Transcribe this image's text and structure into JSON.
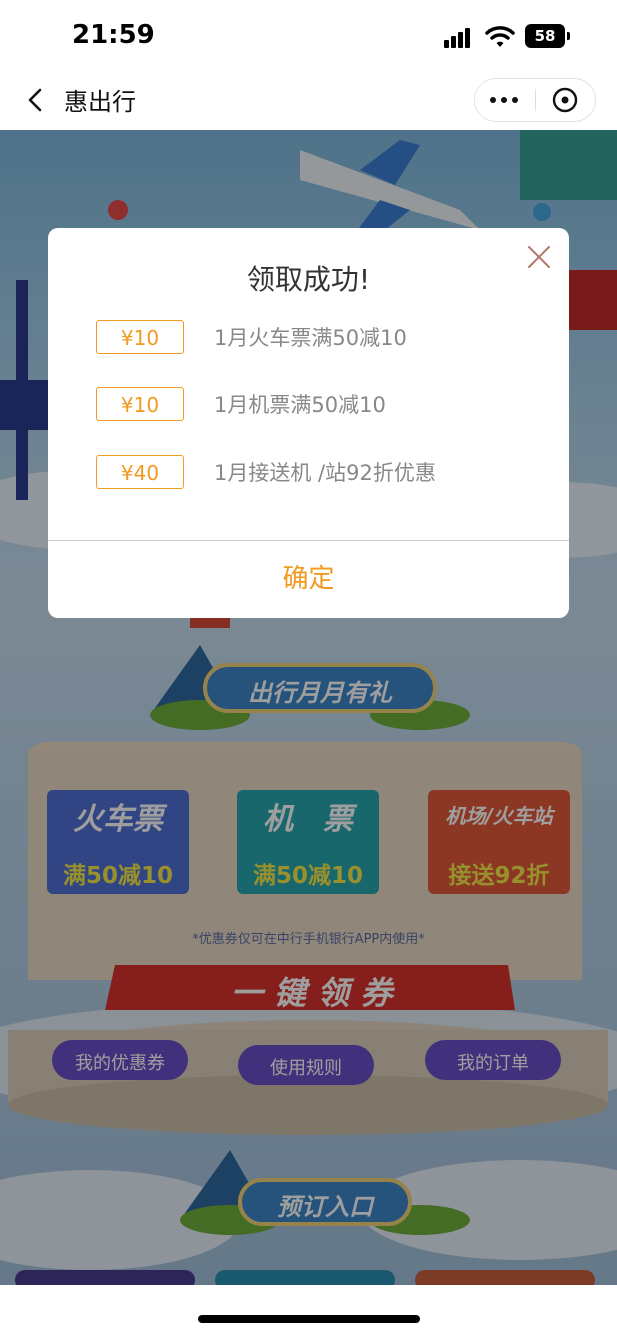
{
  "status": {
    "time": "21:59",
    "battery": "58"
  },
  "nav": {
    "title": "惠出行"
  },
  "bg": {
    "section1_title": "出行月月有礼",
    "cards": [
      {
        "title": "火车票",
        "offer": "满50减10"
      },
      {
        "title": "机　票",
        "offer": "满50减10"
      },
      {
        "title": "机场/火车站",
        "offer": "接送92折"
      }
    ],
    "note": "*优惠券仅可在中行手机银行APP内使用*",
    "claim_button": "一 键 领 券",
    "bottom_buttons": [
      "我的优惠券",
      "使用规则",
      "我的订单"
    ],
    "section2_title": "预订入口"
  },
  "modal": {
    "title": "领取成功!",
    "coupons": [
      {
        "amount": "¥10",
        "desc": "1月火车票满50减10"
      },
      {
        "amount": "¥10",
        "desc": "1月机票满50减10"
      },
      {
        "amount": "¥40",
        "desc": "1月接送机 /站92折优惠"
      }
    ],
    "confirm": "确定"
  },
  "colors": {
    "accent": "#f29a1f"
  }
}
